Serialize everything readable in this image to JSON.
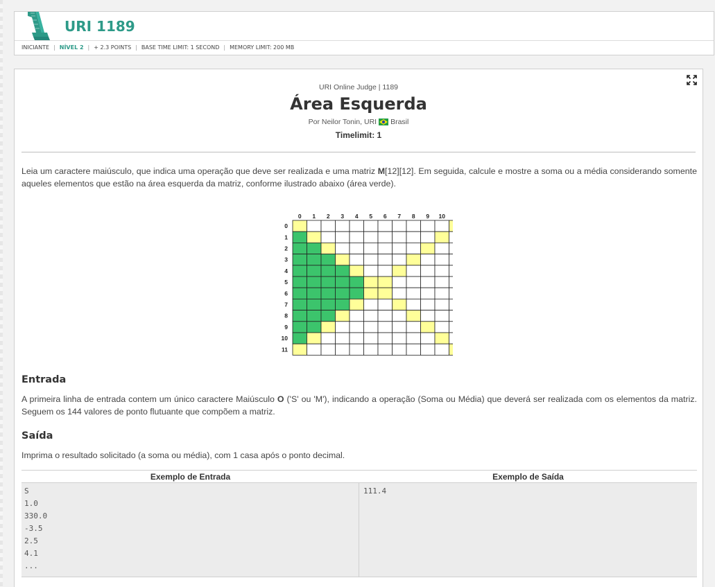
{
  "header": {
    "problem_code": "URI 1189",
    "meta": {
      "category": "INICIANTE",
      "level": "NÍVEL 2",
      "points": "+ 2.3 POINTS",
      "base_time": "BASE TIME LIMIT: 1 SECOND",
      "memory": "MEMORY LIMIT: 200 MB"
    }
  },
  "problem": {
    "judge_line": "URI Online Judge | 1189",
    "title": "Área Esquerda",
    "author_prefix": "Por Neilor Tonin, URI",
    "country": "Brasil",
    "timelimit": "Timelimit: 1",
    "description": {
      "before": "Leia um caractere maiúsculo, que indica uma operação que deve ser realizada e uma matriz ",
      "bold": "M",
      "after": "[12][12]. Em seguida, calcule e mostre a soma ou a média considerando somente aqueles elementos que estão na área esquerda da matriz, conforme ilustrado abaixo (área verde)."
    }
  },
  "matrix": {
    "size": 12,
    "labels": [
      "0",
      "1",
      "2",
      "3",
      "4",
      "5",
      "6",
      "7",
      "8",
      "9",
      "10",
      "11"
    ],
    "colors": {
      "green": "#3cc46c",
      "yellow": "#ffff99",
      "white": "#ffffff",
      "border": "#222222"
    }
  },
  "input_section": {
    "title": "Entrada",
    "text_before": "A primeira linha de entrada contem um único caractere Maiúsculo ",
    "text_bold": "O",
    "text_after": " ('S' ou 'M'), indicando a operação (Soma ou Média) que deverá ser realizada com os elementos da matriz. Seguem os 144 valores de ponto flutuante que compõem a matriz."
  },
  "output_section": {
    "title": "Saída",
    "text": "Imprima o resultado solicitado (a soma ou média), com 1 casa após o ponto decimal."
  },
  "examples": {
    "input_header": "Exemplo de Entrada",
    "output_header": "Exemplo de Saída",
    "input_lines": [
      "S",
      "1.0",
      "330.0",
      "-3.5",
      "2.5",
      "4.1",
      "..."
    ],
    "output_lines": [
      "111.4"
    ]
  },
  "colors": {
    "brand": "#2d9a88"
  }
}
